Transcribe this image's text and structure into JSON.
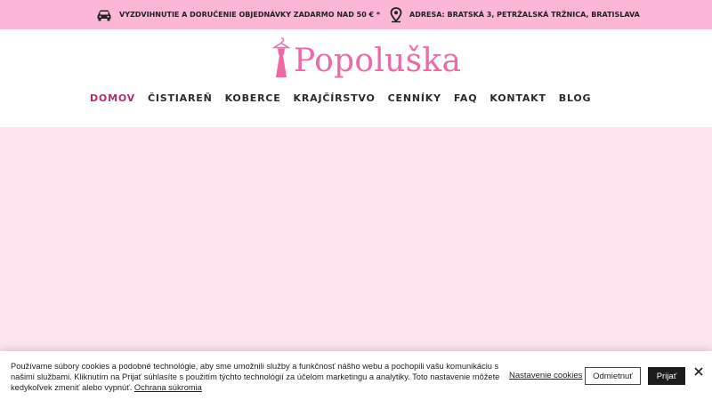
{
  "topbar": {
    "delivery_text": "VYZDVIHNUTIE A DORUČENIE OBJEDNÁVKY ZADARMO NAD 50 € *",
    "address_text": "ADRESA: BRATSKÁ 3, PETRŽALSKÁ TRŽNICA, BRATISLAVA",
    "delivery_icon": "car-icon",
    "address_icon": "map-pin-icon"
  },
  "logo": {
    "text": "Popoluška",
    "icon": "dress-on-hanger-icon"
  },
  "nav": {
    "items": [
      {
        "label": "DOMOV",
        "active": true
      },
      {
        "label": "ČISTIAREŇ"
      },
      {
        "label": "KOBERCE"
      },
      {
        "label": "KRAJČÍRSTVO"
      },
      {
        "label": "CENNÍKY"
      },
      {
        "label": "FAQ"
      },
      {
        "label": "KONTAKT"
      },
      {
        "label": "BLOG"
      }
    ]
  },
  "cookie": {
    "text": "Používame súbory cookies a podobné technológie, aby sme umožnili služby a funkčnosť nášho webu a pochopili vašu komunikáciu s našimi službami. Kliknutím na Prijať súhlasíte s použitím týchto technológií za účelom marketingu a analytiky. Toto nastavenie môžete kedykoľvek zmeniť alebo vypnúť.",
    "privacy_link": "Ochrana súkromia",
    "settings_link": "Nastavenie cookies",
    "reject_label": "Odmietnuť",
    "accept_label": "Prijať",
    "close_icon": "close-icon"
  },
  "colors": {
    "topbar_bg": "#fbb7d5",
    "brand_pink": "#ee6aa7",
    "nav_active": "#b03071",
    "hero_bg": "#fde4ef"
  }
}
